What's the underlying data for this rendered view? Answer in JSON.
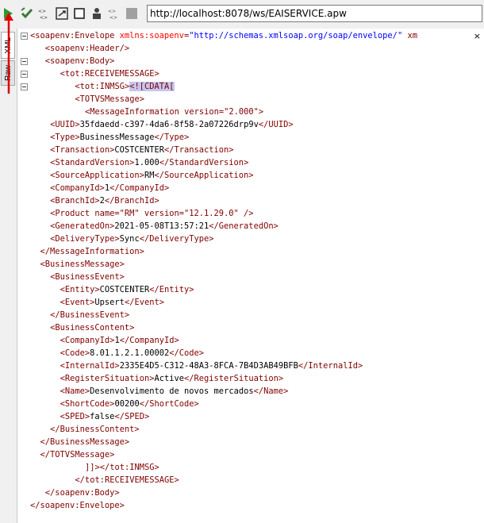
{
  "toolbar": {
    "buttons": [
      {
        "name": "run-icon",
        "color": "#2e9a2e"
      },
      {
        "name": "validate-icon",
        "color": "#3a8a3a"
      },
      {
        "name": "format-xml-icon",
        "color": "#333333"
      },
      {
        "name": "wsdl-icon",
        "color": "#333333"
      },
      {
        "name": "stop-icon",
        "color": "#333333"
      },
      {
        "name": "user-icon",
        "color": "#333333"
      },
      {
        "name": "schema-icon",
        "color": "#333333"
      },
      {
        "name": "disabled-square-icon",
        "color": "#a0a0a0"
      }
    ],
    "url": "http://localhost:8078/ws/EAISERVICE.apw"
  },
  "side_tabs": {
    "xml": "XML",
    "raw": "Raw"
  },
  "editor": {
    "close_symbol": "×",
    "lines": [
      {
        "indent": 0,
        "parts": [
          [
            "t",
            "<soapenv:Envelope "
          ],
          [
            "an",
            "xmlns:soapenv"
          ],
          [
            "t",
            "="
          ],
          [
            "av",
            "\"http://schemas.xmlsoap.org/soap/envelope/\""
          ],
          [
            "t",
            " xm"
          ]
        ]
      },
      {
        "indent": 3,
        "parts": [
          [
            "t",
            "<soapenv:Header/>"
          ]
        ]
      },
      {
        "indent": 3,
        "parts": [
          [
            "t",
            "<soapenv:Body>"
          ]
        ]
      },
      {
        "indent": 6,
        "parts": [
          [
            "t",
            "<tot:RECEIVEMESSAGE>"
          ]
        ]
      },
      {
        "indent": 9,
        "parts": [
          [
            "t",
            "<tot:INMSG>"
          ],
          [
            "cdata",
            "<![CDATA["
          ]
        ]
      },
      {
        "indent": 9,
        "parts": [
          [
            "t",
            "<TOTVSMessage>"
          ]
        ]
      },
      {
        "indent": 11,
        "parts": [
          [
            "t",
            "<MessageInformation version=\"2.000\">"
          ]
        ]
      },
      {
        "indent": 4,
        "parts": [
          [
            "t",
            "<UUID>"
          ],
          [
            "txt",
            "35fdaedd-c397-4da6-8f58-2a07226drp9v"
          ],
          [
            "t",
            "</UUID>"
          ]
        ]
      },
      {
        "indent": 4,
        "parts": [
          [
            "t",
            "<Type>"
          ],
          [
            "txt",
            "BusinessMessage"
          ],
          [
            "t",
            "</Type>"
          ]
        ]
      },
      {
        "indent": 4,
        "parts": [
          [
            "t",
            "<Transaction>"
          ],
          [
            "txt",
            "COSTCENTER"
          ],
          [
            "t",
            "</Transaction>"
          ]
        ]
      },
      {
        "indent": 4,
        "parts": [
          [
            "t",
            "<StandardVersion>"
          ],
          [
            "txt",
            "1.000"
          ],
          [
            "t",
            "</StandardVersion>"
          ]
        ]
      },
      {
        "indent": 4,
        "parts": [
          [
            "t",
            "<SourceApplication>"
          ],
          [
            "txt",
            "RM"
          ],
          [
            "t",
            "</SourceApplication>"
          ]
        ]
      },
      {
        "indent": 4,
        "parts": [
          [
            "t",
            "<CompanyId>"
          ],
          [
            "txt",
            "1"
          ],
          [
            "t",
            "</CompanyId>"
          ]
        ]
      },
      {
        "indent": 4,
        "parts": [
          [
            "t",
            "<BranchId>"
          ],
          [
            "txt",
            "2"
          ],
          [
            "t",
            "</BranchId>"
          ]
        ]
      },
      {
        "indent": 4,
        "parts": [
          [
            "t",
            "<Product name=\"RM\" version=\"12.1.29.0\" />"
          ]
        ]
      },
      {
        "indent": 4,
        "parts": [
          [
            "t",
            "<GeneratedOn>"
          ],
          [
            "txt",
            "2021-05-08T13:57:21"
          ],
          [
            "t",
            "</GeneratedOn>"
          ]
        ]
      },
      {
        "indent": 4,
        "parts": [
          [
            "t",
            "<DeliveryType>"
          ],
          [
            "txt",
            "Sync"
          ],
          [
            "t",
            "</DeliveryType>"
          ]
        ]
      },
      {
        "indent": 2,
        "parts": [
          [
            "t",
            "</MessageInformation>"
          ]
        ]
      },
      {
        "indent": 2,
        "parts": [
          [
            "t",
            "<BusinessMessage>"
          ]
        ]
      },
      {
        "indent": 4,
        "parts": [
          [
            "t",
            "<BusinessEvent>"
          ]
        ]
      },
      {
        "indent": 6,
        "parts": [
          [
            "t",
            "<Entity>"
          ],
          [
            "txt",
            "COSTCENTER"
          ],
          [
            "t",
            "</Entity>"
          ]
        ]
      },
      {
        "indent": 6,
        "parts": [
          [
            "t",
            "<Event>"
          ],
          [
            "txt",
            "Upsert"
          ],
          [
            "t",
            "</Event>"
          ]
        ]
      },
      {
        "indent": 4,
        "parts": [
          [
            "t",
            "</BusinessEvent>"
          ]
        ]
      },
      {
        "indent": 4,
        "parts": [
          [
            "t",
            "<BusinessContent>"
          ]
        ]
      },
      {
        "indent": 6,
        "parts": [
          [
            "t",
            "<CompanyId>"
          ],
          [
            "txt",
            "1"
          ],
          [
            "t",
            "</CompanyId>"
          ]
        ]
      },
      {
        "indent": 6,
        "parts": [
          [
            "t",
            "<Code>"
          ],
          [
            "txt",
            "8.01.1.2.1.00002"
          ],
          [
            "t",
            "</Code>"
          ]
        ]
      },
      {
        "indent": 6,
        "parts": [
          [
            "t",
            "<InternalId>"
          ],
          [
            "txt",
            "2335E4D5-C312-48A3-8FCA-7B4D3AB49BFB"
          ],
          [
            "t",
            "</InternalId>"
          ]
        ]
      },
      {
        "indent": 6,
        "parts": [
          [
            "t",
            "<RegisterSituation>"
          ],
          [
            "txt",
            "Active"
          ],
          [
            "t",
            "</RegisterSituation>"
          ]
        ]
      },
      {
        "indent": 6,
        "parts": [
          [
            "t",
            "<Name>"
          ],
          [
            "txt",
            "Desenvolvimento de novos mercados"
          ],
          [
            "t",
            "</Name>"
          ]
        ]
      },
      {
        "indent": 6,
        "parts": [
          [
            "t",
            "<ShortCode>"
          ],
          [
            "txt",
            "00200"
          ],
          [
            "t",
            "</ShortCode>"
          ]
        ]
      },
      {
        "indent": 6,
        "parts": [
          [
            "t",
            "<SPED>"
          ],
          [
            "txt",
            "false"
          ],
          [
            "t",
            "</SPED>"
          ]
        ]
      },
      {
        "indent": 4,
        "parts": [
          [
            "t",
            "</BusinessContent>"
          ]
        ]
      },
      {
        "indent": 2,
        "parts": [
          [
            "t",
            "</BusinessMessage>"
          ]
        ]
      },
      {
        "indent": 2,
        "parts": [
          [
            "t",
            "</TOTVSMessage>"
          ]
        ]
      },
      {
        "indent": 11,
        "parts": [
          [
            "t",
            "]]></tot:INMSG>"
          ]
        ]
      },
      {
        "indent": 9,
        "parts": [
          [
            "t",
            "</tot:RECEIVEMESSAGE>"
          ]
        ]
      },
      {
        "indent": 3,
        "parts": [
          [
            "t",
            "</soapenv:Body>"
          ]
        ]
      },
      {
        "indent": 0,
        "parts": [
          [
            "t",
            "</soapenv:Envelope>"
          ]
        ]
      }
    ],
    "fold_lines": [
      0,
      2,
      3,
      4
    ]
  }
}
